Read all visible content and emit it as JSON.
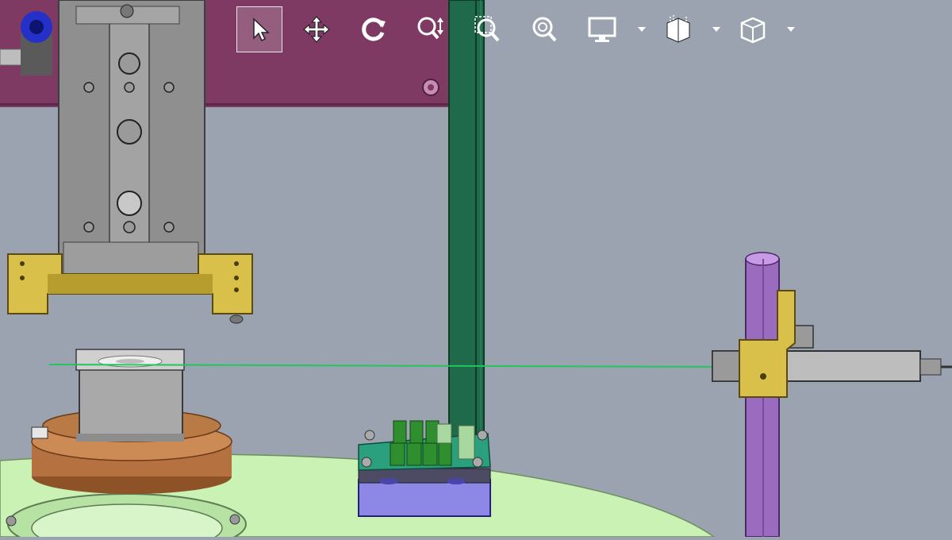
{
  "app": {
    "kind": "3D CAD assembly viewport (heads-up view toolbar)"
  },
  "toolbar": {
    "tools": [
      {
        "id": "select",
        "icon": "pointer-arrow-icon",
        "active": true
      },
      {
        "id": "pan",
        "icon": "move-arrows-icon",
        "active": false
      },
      {
        "id": "rotate",
        "icon": "rotate-icon",
        "active": false
      },
      {
        "id": "zoom-in-out",
        "icon": "zoom-in-out-icon",
        "active": false
      },
      {
        "id": "zoom-to-area",
        "icon": "zoom-to-area-icon",
        "active": false
      },
      {
        "id": "zoom-to-fit",
        "icon": "zoom-to-fit-icon",
        "active": false
      },
      {
        "id": "display-style",
        "icon": "monitor-icon",
        "has_dropdown": true
      },
      {
        "id": "section-view",
        "icon": "section-cube-icon",
        "has_dropdown": true
      },
      {
        "id": "view-orientation",
        "icon": "cube-icon",
        "has_dropdown": true
      }
    ],
    "icon_color": "#ffffff",
    "active_highlight": "#ffffff"
  },
  "scene": {
    "background_color": "#9aa3af",
    "colors": {
      "bracket_magenta": "#7e3a62",
      "cylinder_gray": "#8f8f8f",
      "mount_yellow": "#d8c04a",
      "green_post": "#1f6a4a",
      "turntable_bronze": "#b57140",
      "platform_green": "#c9f2b4",
      "pcb_teal": "#2ba07e",
      "block_blue": "#8d87e6",
      "rod_purple": "#9b6bc0",
      "laser_line": "#22c55e"
    }
  }
}
